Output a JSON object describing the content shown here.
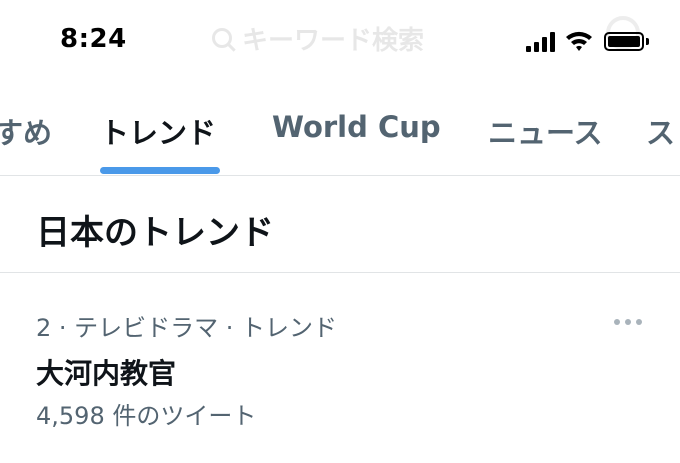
{
  "status_bar": {
    "time": "8:24",
    "search_hint": "キーワード検索"
  },
  "tabs": [
    {
      "label": "すめ",
      "active": false
    },
    {
      "label": "トレンド",
      "active": true
    },
    {
      "label": "World Cup",
      "active": false
    },
    {
      "label": "ニュース",
      "active": false
    },
    {
      "label": "ス",
      "active": false
    }
  ],
  "section": {
    "title": "日本のトレンド"
  },
  "trend": {
    "meta": "2 · テレビドラマ · トレンド",
    "name": "大河内教官",
    "count": "4,598 件のツイート"
  },
  "colors": {
    "accent": "#4a99e9",
    "secondary_text": "#536471",
    "primary_text": "#0f1419",
    "divider": "#e1e4e6"
  },
  "icons": {
    "signal": "cellular-signal-icon",
    "wifi": "wifi-icon",
    "battery": "battery-icon",
    "more": "more-horizontal-icon"
  }
}
